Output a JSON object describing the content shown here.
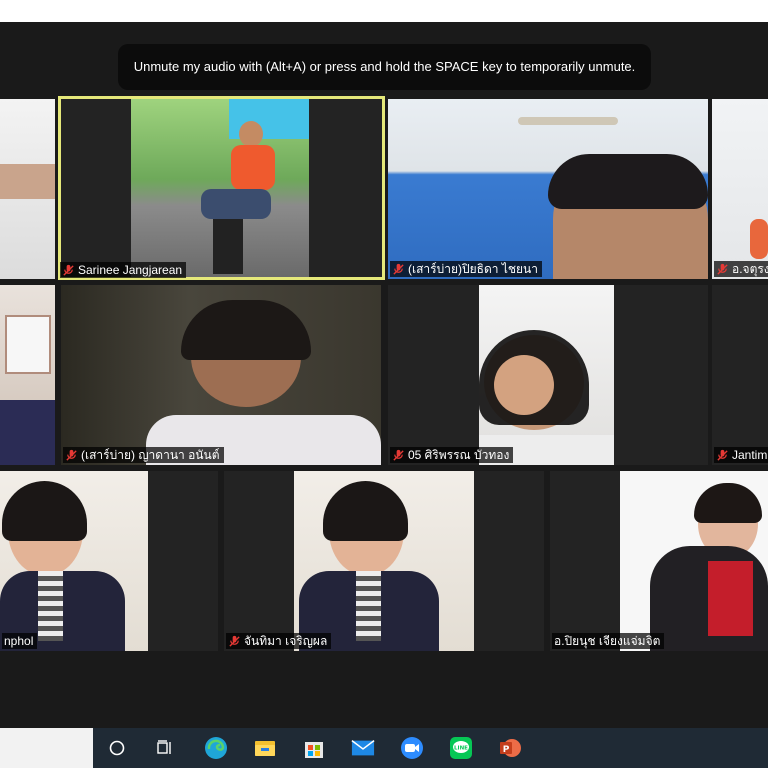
{
  "notification": {
    "text": "Unmute my audio with (Alt+A) or press and hold the SPACE key to temporarily unmute."
  },
  "participants": [
    {
      "name": "Sarinee Jangjarean",
      "muted": true,
      "active_speaker": true
    },
    {
      "name": "(เสาร์บ่าย)ปิยธิดา ไชยนา",
      "muted": true,
      "active_speaker": false
    },
    {
      "name": "อ.จตุรง",
      "muted": true,
      "active_speaker": false
    },
    {
      "name": "(เสาร์บ่าย) ญาดานา อนันต์",
      "muted": true,
      "active_speaker": false
    },
    {
      "name": "05 ศิริพรรณ บัวทอง",
      "muted": true,
      "active_speaker": false
    },
    {
      "name": "Jantim",
      "muted": true,
      "active_speaker": false
    },
    {
      "name": "nphol",
      "muted": false,
      "active_speaker": false
    },
    {
      "name": "จันทิมา เจริญผล",
      "muted": true,
      "active_speaker": false
    },
    {
      "name": "อ.ปิยนุช เจียงแจ่มจิต",
      "muted": false,
      "active_speaker": false
    }
  ],
  "taskbar": {
    "icons": [
      "task-view-circle-icon",
      "timeline-icon",
      "edge-icon",
      "file-explorer-icon",
      "store-icon",
      "mail-icon",
      "zoom-icon",
      "line-icon",
      "powerpoint-icon"
    ],
    "colors": {
      "edge": "#1fa6d8",
      "explorer": "#f4c02f",
      "mail": "#1e88e5",
      "zoom": "#2d8cff",
      "line": "#06c755",
      "powerpoint": "#d24726"
    }
  },
  "theme": {
    "active_speaker_border": "#e5e87a",
    "background": "#1a1a1a"
  }
}
